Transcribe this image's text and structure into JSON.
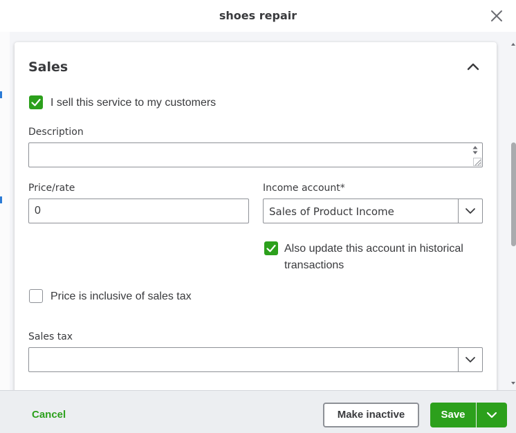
{
  "header": {
    "title": "shoes repair"
  },
  "sales": {
    "section_title": "Sales",
    "sell_checkbox": {
      "label": "I sell this service to my customers",
      "checked": true
    },
    "description": {
      "label": "Description",
      "value": ""
    },
    "price": {
      "label": "Price/rate",
      "value": "0"
    },
    "income_account": {
      "label": "Income account*",
      "value": "Sales of Product Income"
    },
    "historical_checkbox": {
      "line1": "Also update this account in historical",
      "line2": "transactions",
      "checked": true
    },
    "inclusive_checkbox": {
      "label": "Price is inclusive of sales tax",
      "checked": false
    },
    "sales_tax": {
      "label": "Sales tax",
      "value": ""
    }
  },
  "footer": {
    "cancel_label": "Cancel",
    "make_inactive_label": "Make inactive",
    "save_label": "Save"
  },
  "colors": {
    "accent": "#2ca01c",
    "text": "#393a3d",
    "border": "#8d9096"
  },
  "icons": [
    "close-icon",
    "chevron-up-icon",
    "check-icon",
    "chevron-down-icon",
    "spinner-icon",
    "resize-grip-icon"
  ]
}
